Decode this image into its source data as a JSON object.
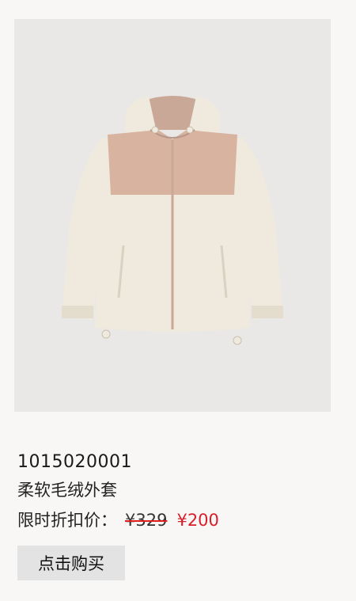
{
  "product": {
    "id": "1015020001",
    "name": "柔软毛绒外套",
    "price_label": "限时折扣价：",
    "original_price": "¥329",
    "sale_price": "¥200",
    "buy_label": "点击购买",
    "image_icon": "fleece-jacket-image"
  },
  "colors": {
    "background": "#f8f7f6",
    "image_bg": "#e9e8e7",
    "sale_price": "#d81e2a",
    "strikethrough": "#e02020",
    "button_bg": "#e3e3e3"
  }
}
